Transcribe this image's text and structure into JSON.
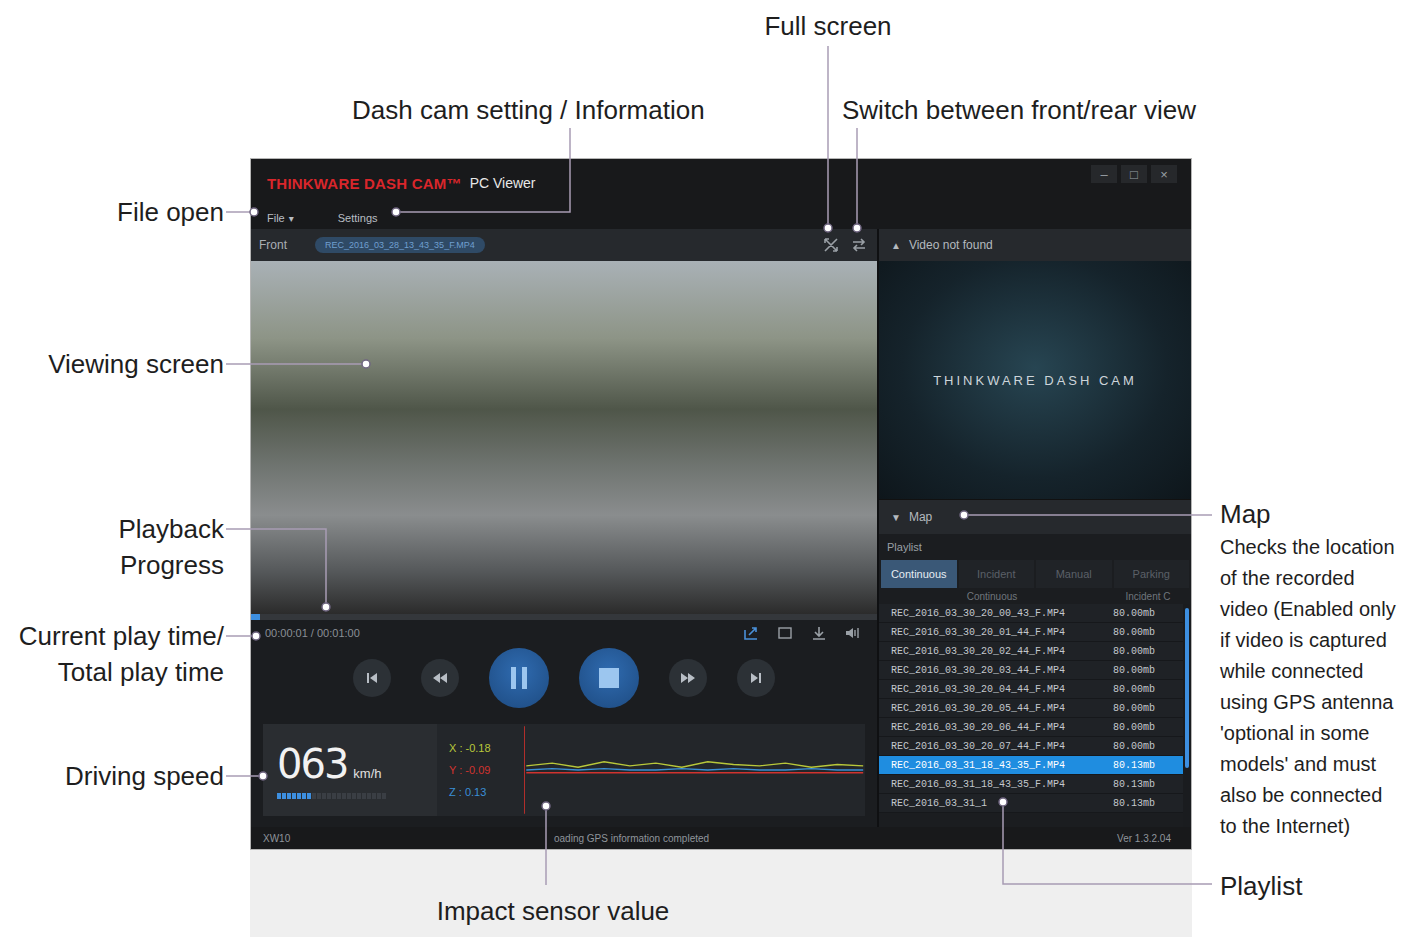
{
  "callouts": [
    {
      "lines": [
        "Full screen"
      ],
      "note": []
    },
    {
      "lines": [
        "Dash cam setting / Information"
      ],
      "note": []
    },
    {
      "lines": [
        "Switch between front/rear view"
      ],
      "note": []
    },
    {
      "lines": [
        "File open"
      ],
      "note": []
    },
    {
      "lines": [
        "Viewing screen"
      ],
      "note": []
    },
    {
      "lines": [
        "Playback",
        "Progress"
      ],
      "note": []
    },
    {
      "lines": [
        "Current play time/",
        "Total play time"
      ],
      "note": []
    },
    {
      "lines": [
        "Driving speed"
      ],
      "note": []
    },
    {
      "lines": [
        "Impact sensor value"
      ],
      "note": []
    },
    {
      "lines": [
        "Map"
      ],
      "note": [
        "Checks the location",
        "of the recorded",
        "video (Enabled only",
        "if video is captured",
        "while connected",
        "using GPS antenna",
        "'optional in some",
        "models' and must",
        "also be connected",
        "to the Internet)"
      ]
    },
    {
      "lines": [
        "Playlist"
      ],
      "note": []
    }
  ],
  "window": {
    "brand": "THINKWARE DASH CAM™",
    "subtitle": "PC Viewer",
    "controls": [
      "–",
      "□",
      "×"
    ]
  },
  "menu": [
    {
      "label": "File",
      "arrow": "▾"
    },
    {
      "label": "Settings",
      "arrow": ""
    }
  ],
  "viewer": {
    "view": "Front",
    "file": "REC_2016_03_28_13_43_35_F.MP4",
    "progress": 0.015,
    "time": "00:00:01 / 00:01:00",
    "playing": true
  },
  "second_view": {
    "arrow": "▲",
    "status": "Video not found",
    "logo": "THINKWARE DASH CAM"
  },
  "map": {
    "arrow": "▼",
    "label": "Map"
  },
  "playlist": {
    "title": "Playlist",
    "tabs": [
      {
        "label": "Continuous",
        "selected": true
      },
      {
        "label": "Incident",
        "selected": false
      },
      {
        "label": "Manual",
        "selected": false
      },
      {
        "label": "Parking",
        "selected": false
      }
    ],
    "columns": [
      "Continuous",
      "Incident C"
    ],
    "rows": [
      {
        "name": "REC_2016_03_30_20_00_43_F.MP4",
        "size": "80.00mb",
        "selected": false
      },
      {
        "name": "REC_2016_03_30_20_01_44_F.MP4",
        "size": "80.00mb",
        "selected": false
      },
      {
        "name": "REC_2016_03_30_20_02_44_F.MP4",
        "size": "80.00mb",
        "selected": false
      },
      {
        "name": "REC_2016_03_30_20_03_44_F.MP4",
        "size": "80.00mb",
        "selected": false
      },
      {
        "name": "REC_2016_03_30_20_04_44_F.MP4",
        "size": "80.00mb",
        "selected": false
      },
      {
        "name": "REC_2016_03_30_20_05_44_F.MP4",
        "size": "80.00mb",
        "selected": false
      },
      {
        "name": "REC_2016_03_30_20_06_44_F.MP4",
        "size": "80.00mb",
        "selected": false
      },
      {
        "name": "REC_2016_03_30_20_07_44_F.MP4",
        "size": "80.00mb",
        "selected": false
      },
      {
        "name": "REC_2016_03_31_18_43_35_F.MP4",
        "size": "80.13mb",
        "selected": true
      },
      {
        "name": "REC_2016_03_31_18_43_35_F.MP4",
        "size": "80.13mb",
        "selected": false
      },
      {
        "name": "REC_2016_03_31_1",
        "size": "80.13mb",
        "selected": false
      }
    ]
  },
  "speed": {
    "value": "063",
    "unit": "km/h",
    "level": 0.3
  },
  "sensor": {
    "series": [
      {
        "text": "X : -0.18",
        "color": "#b9c83a",
        "values": [
          0.03,
          0.05,
          0.02,
          0.06,
          0.03,
          0.05,
          0.02,
          0.06,
          0.04,
          0.03,
          0.05,
          0.02,
          0.04,
          0.03
        ]
      },
      {
        "text": "Y : -0.09",
        "color": "#d0332f",
        "values": [
          -0.02,
          -0.02,
          -0.02,
          -0.02,
          -0.02,
          -0.02,
          -0.02,
          -0.02,
          -0.02,
          -0.02,
          -0.02,
          -0.02,
          -0.02,
          -0.02
        ]
      },
      {
        "text": "Z : 0.13",
        "color": "#3a8fd6",
        "values": [
          0.0,
          0.01,
          0.0,
          0.01,
          0.0,
          0.0,
          0.01,
          0.0,
          0.01,
          0.0,
          0.0,
          0.01,
          0.0,
          0.0
        ]
      }
    ]
  },
  "status_bar": {
    "model": "XW10",
    "message": "oading GPS information completed",
    "version": "Ver 1.3.2.04"
  }
}
